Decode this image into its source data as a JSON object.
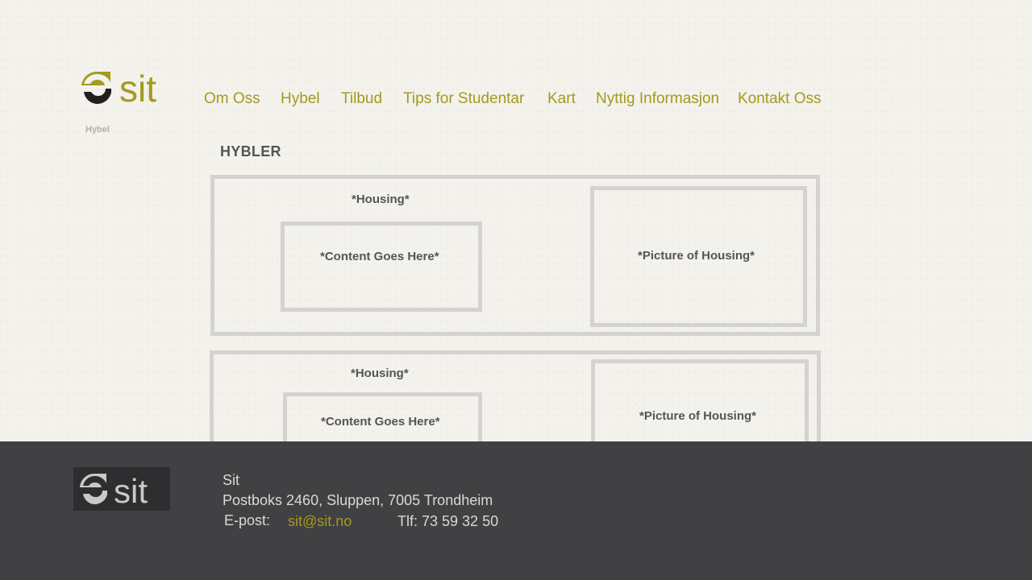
{
  "brand": {
    "logo_text": "sit"
  },
  "breadcrumb": "Hybel",
  "nav": {
    "items": [
      "Om Oss",
      "Hybel",
      "Tilbud",
      "Tips for Studentar",
      "Kart",
      "Nyttig Informasjon",
      "Kontakt Oss"
    ]
  },
  "main": {
    "title": "HYBLER",
    "listings": [
      {
        "heading": "*Housing*",
        "content": "*Content Goes Here*",
        "picture": "*Picture of Housing*"
      },
      {
        "heading": "*Housing*",
        "content": "*Content Goes Here*",
        "picture": "*Picture of Housing*"
      }
    ]
  },
  "footer": {
    "logo_text": "sit",
    "org": "Sit",
    "address": "Postboks 2460, Sluppen, 7005 Trondheim",
    "email_label": "E-post:",
    "email": "sit@sit.no",
    "phone": "Tlf: 73 59 32 50"
  },
  "colors": {
    "accent": "#a39a1e",
    "background": "#f4f2ec",
    "footer_bg": "#414042",
    "box_border": "#d4d3cf"
  }
}
